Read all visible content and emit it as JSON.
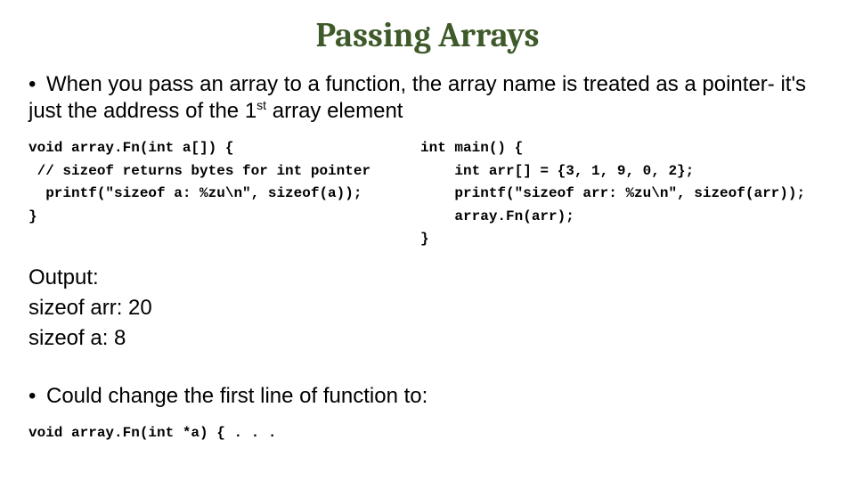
{
  "title": "Passing Arrays",
  "bullet1_prefix": "When you pass an array to a function, the array name is treated as a pointer- it's just the address of the 1",
  "bullet1_sup": "st",
  "bullet1_suffix": " array element",
  "code_left": "void array.Fn(int a[]) {\n // sizeof returns bytes for int pointer\n  printf(\"sizeof a: %zu\\n\", sizeof(a));\n}",
  "code_right": "int main() {\n    int arr[] = {3, 1, 9, 0, 2};\n    printf(\"sizeof arr: %zu\\n\", sizeof(arr));\n    array.Fn(arr);\n}",
  "output_label": "Output:",
  "output_line1": "sizeof arr: 20",
  "output_line2": "sizeof a: 8",
  "bullet2": "Could change the first line of function to:",
  "code_bottom": "void array.Fn(int *a) { . . ."
}
